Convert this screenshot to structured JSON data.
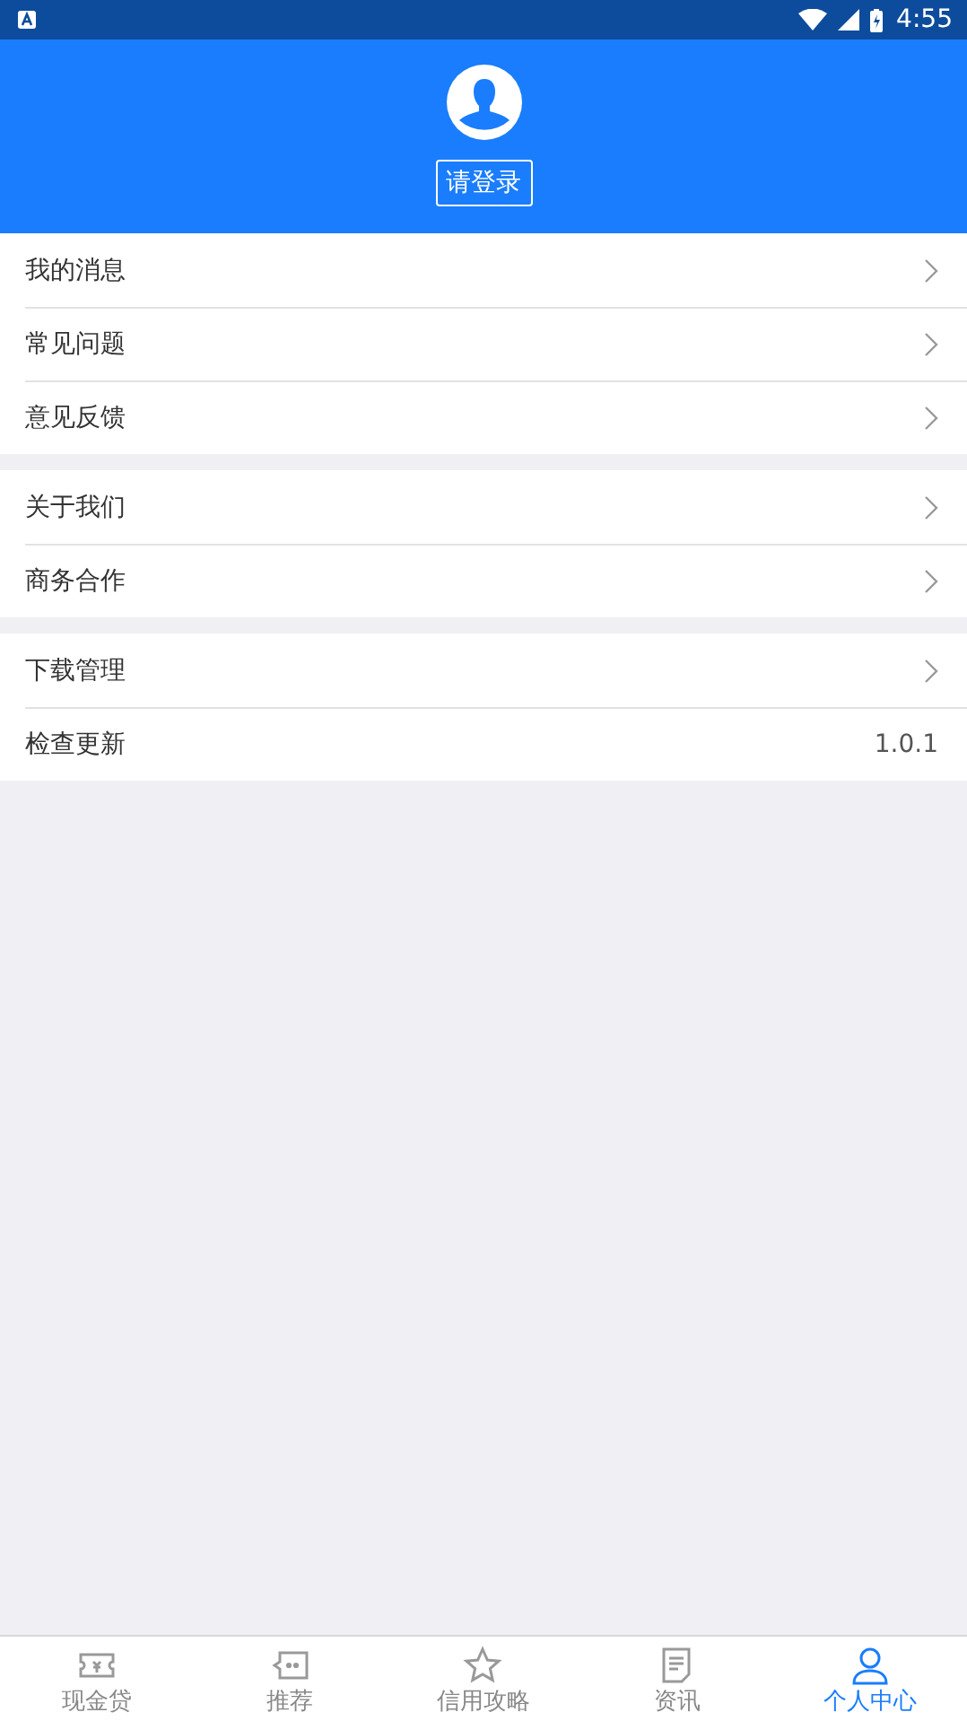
{
  "status_bar": {
    "time": "4:55"
  },
  "header": {
    "login_button": "请登录"
  },
  "menu_groups": [
    {
      "items": [
        {
          "label": "我的消息",
          "kind": "link"
        },
        {
          "label": "常见问题",
          "kind": "link"
        },
        {
          "label": "意见反馈",
          "kind": "link"
        }
      ]
    },
    {
      "items": [
        {
          "label": "关于我们",
          "kind": "link"
        },
        {
          "label": "商务合作",
          "kind": "link"
        }
      ]
    },
    {
      "items": [
        {
          "label": "下载管理",
          "kind": "link"
        },
        {
          "label": "检查更新",
          "kind": "value",
          "value": "1.0.1"
        }
      ]
    }
  ],
  "tab_bar": [
    {
      "label": "现金贷",
      "selected": false
    },
    {
      "label": "推荐",
      "selected": false
    },
    {
      "label": "信用攻略",
      "selected": false
    },
    {
      "label": "资讯",
      "selected": false
    },
    {
      "label": "个人中心",
      "selected": true
    }
  ]
}
